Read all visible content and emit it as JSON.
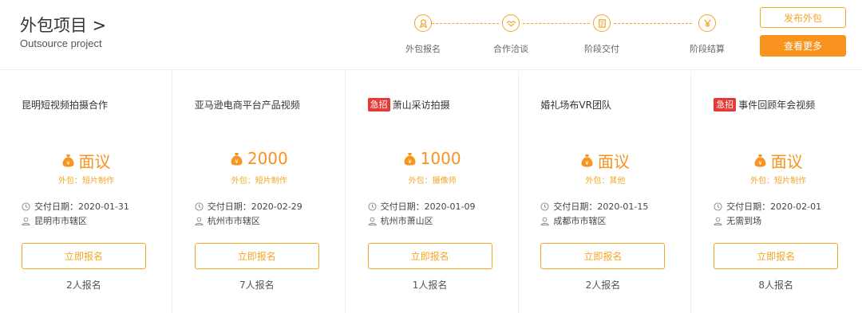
{
  "header": {
    "title": "外包项目 >",
    "subtitle": "Outsource project",
    "publish_label": "发布外包",
    "more_label": "查看更多"
  },
  "steps": [
    {
      "label": "外包报名",
      "icon": "signup-icon"
    },
    {
      "label": "合作洽谈",
      "icon": "handshake-icon"
    },
    {
      "label": "阶段交付",
      "icon": "delivery-icon"
    },
    {
      "label": "阶段结算",
      "icon": "yen-icon"
    }
  ],
  "colors": {
    "accent": "#f7931e",
    "accent_light": "#f5a623",
    "urgent": "#e53935",
    "divider": "#eeeeee"
  },
  "cards": [
    {
      "title": "昆明短视频拍摄合作",
      "urgent": "",
      "price": "面议",
      "category": "外包：短片制作",
      "date": "交付日期：2020-01-31",
      "location": "昆明市市辖区",
      "apply": "立即报名",
      "count": "2人报名"
    },
    {
      "title": "亚马逊电商平台产品视频",
      "urgent": "",
      "price": "2000",
      "category": "外包：短片制作",
      "date": "交付日期：2020-02-29",
      "location": "杭州市市辖区",
      "apply": "立即报名",
      "count": "7人报名"
    },
    {
      "title": "萧山采访拍摄",
      "urgent": "急招",
      "price": "1000",
      "category": "外包：摄像师",
      "date": "交付日期：2020-01-09",
      "location": "杭州市萧山区",
      "apply": "立即报名",
      "count": "1人报名"
    },
    {
      "title": "婚礼场布VR团队",
      "urgent": "",
      "price": "面议",
      "category": "外包：其他",
      "date": "交付日期：2020-01-15",
      "location": "成都市市辖区",
      "apply": "立即报名",
      "count": "2人报名"
    },
    {
      "title": "事件回顾年会视频",
      "urgent": "急招",
      "price": "面议",
      "category": "外包：短片制作",
      "date": "交付日期：2020-02-01",
      "location": "无需到场",
      "apply": "立即报名",
      "count": "8人报名"
    }
  ]
}
